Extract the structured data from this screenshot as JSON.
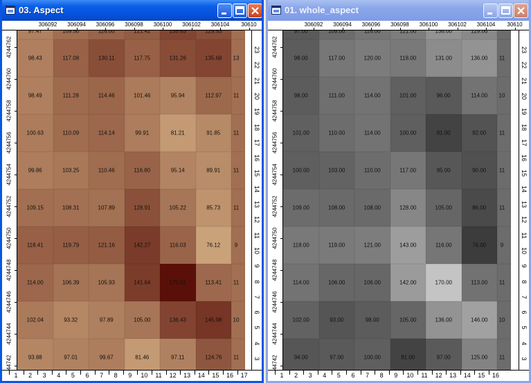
{
  "windows": [
    {
      "id": "left",
      "title": "03. Aspect",
      "x_ticks": [
        "306092",
        "306094",
        "306096",
        "306098",
        "306100",
        "306102",
        "306104",
        "30610"
      ],
      "y_ticks": [
        "4244762",
        "4244760",
        "4244758",
        "4244756",
        "4244754",
        "4244752",
        "4244750",
        "4244748",
        "4244746",
        "4244744",
        "4244742"
      ],
      "bottom_ticks": [
        "1",
        "2",
        "3",
        "4",
        "5",
        "6",
        "7",
        "8",
        "9",
        "10",
        "11",
        "12",
        "13",
        "14",
        "15",
        "16",
        "17"
      ],
      "right_ticks": [
        "23",
        "22",
        "21",
        "20",
        "19",
        "18",
        "17",
        "16",
        "15",
        "14",
        "13",
        "12",
        "11",
        "10",
        "9",
        "8",
        "7",
        "6",
        "5",
        "4",
        "3",
        "2"
      ],
      "top_row_partial": [
        "97.47",
        "109.50",
        "116.00",
        "121.42",
        "135.63",
        "129.53"
      ],
      "values": [
        [
          "98.43",
          "117.08",
          "130.11",
          "117.75",
          "131.26",
          "135.68"
        ],
        [
          "98.49",
          "111.28",
          "114.46",
          "101.46",
          "95.94",
          "112.97"
        ],
        [
          "100.63",
          "110.09",
          "114.14",
          "99.91",
          "81.21",
          "91.85"
        ],
        [
          "99.86",
          "103.25",
          "110.46",
          "116.80",
          "95.14",
          "89.91"
        ],
        [
          "109.15",
          "108.31",
          "107.89",
          "128.91",
          "105.22",
          "85.73"
        ],
        [
          "118.41",
          "119.79",
          "121.16",
          "142.27",
          "116.03",
          "76.12"
        ],
        [
          "114.00",
          "106.39",
          "105.93",
          "141.64",
          "170.01",
          "113.41"
        ],
        [
          "102.04",
          "93.32",
          "97.89",
          "105.00",
          "136.43",
          "145.98"
        ],
        [
          "93.88",
          "97.01",
          "99.67",
          "81.46",
          "97.11",
          "124.76"
        ]
      ],
      "edge_col_partial": [
        "15",
        "13",
        "11",
        "11",
        "11",
        "11",
        "9",
        "11",
        "10",
        "11"
      ],
      "colors": {
        "ramp_low": "#c9a27a",
        "ramp_high": "#5a1008"
      }
    },
    {
      "id": "right",
      "title": "01. whole_aspect",
      "x_ticks": [
        "306092",
        "306094",
        "306096",
        "306098",
        "306100",
        "306102",
        "306104",
        "30610"
      ],
      "y_ticks": [
        "4244762",
        "4244760",
        "4244758",
        "4244756",
        "4244754",
        "4244752",
        "4244750",
        "4244748",
        "4244746",
        "4244744",
        "4244742"
      ],
      "bottom_ticks": [
        "1",
        "2",
        "3",
        "4",
        "5",
        "6",
        "7",
        "8",
        "9",
        "10",
        "11",
        "12",
        "13",
        "14",
        "15",
        "16"
      ],
      "right_ticks": [
        "23",
        "22",
        "21",
        "20",
        "19",
        "18",
        "17",
        "16",
        "15",
        "14",
        "13",
        "12",
        "11",
        "10",
        "9",
        "8",
        "7",
        "6",
        "5",
        "4",
        "3",
        "2"
      ],
      "top_row_partial": [
        "97.00",
        "109.00",
        "116.00",
        "121.00",
        "136.00",
        "129.00"
      ],
      "values": [
        [
          "98.00",
          "117.00",
          "120.00",
          "118.00",
          "131.00",
          "136.00"
        ],
        [
          "98.00",
          "111.00",
          "114.00",
          "101.00",
          "96.00",
          "114.00"
        ],
        [
          "101.00",
          "110.00",
          "114.00",
          "100.00",
          "81.00",
          "92.00"
        ],
        [
          "100.00",
          "103.00",
          "110.00",
          "117.00",
          "95.00",
          "90.00"
        ],
        [
          "109.00",
          "108.00",
          "108.00",
          "128.00",
          "105.00",
          "86.00"
        ],
        [
          "118.00",
          "119.00",
          "121.00",
          "143.00",
          "116.00",
          "76.00"
        ],
        [
          "114.00",
          "106.00",
          "106.00",
          "142.00",
          "170.00",
          "113.00"
        ],
        [
          "102.00",
          "93.00",
          "98.00",
          "105.00",
          "136.00",
          "146.00"
        ],
        [
          "94.00",
          "97.00",
          "100.00",
          "81.00",
          "97.00",
          "125.00"
        ]
      ],
      "edge_col_partial": [
        "13",
        "11",
        "10",
        "11",
        "11",
        "11",
        "9",
        "11",
        "10",
        "11"
      ],
      "colors": {
        "ramp_low": "#3c3c3c",
        "ramp_high": "#c4c4c4"
      }
    }
  ]
}
